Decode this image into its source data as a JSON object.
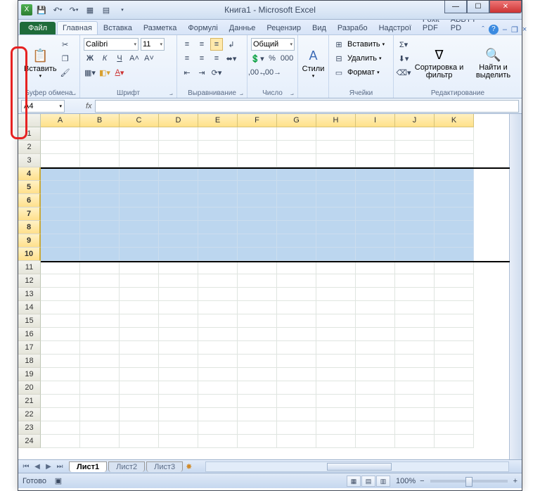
{
  "titlebar": {
    "title": "Книга1 - Microsoft Excel"
  },
  "tabs": {
    "file": "Файл",
    "items": [
      "Главная",
      "Вставка",
      "Разметка",
      "Формулі",
      "Даннье",
      "Рецензир",
      "Вид",
      "Разрабо",
      "Надстрої",
      "Foxit PDF",
      "ABBYY PD"
    ]
  },
  "ribbon": {
    "clipboard": {
      "paste": "Вставить",
      "label": "Буфер обмена"
    },
    "font": {
      "name": "Calibri",
      "size": "11",
      "label": "Шрифт"
    },
    "align": {
      "label": "Выравнивание"
    },
    "number": {
      "format": "Общий",
      "label": "Число"
    },
    "styles": {
      "btn": "Стили"
    },
    "cells": {
      "insert": "Вставить",
      "delete": "Удалить",
      "format": "Формат",
      "label": "Ячейки"
    },
    "editing": {
      "sort": "Сортировка и фильтр",
      "find": "Найти и выделить",
      "label": "Редактирование"
    }
  },
  "namebox": "A4",
  "columns": [
    "A",
    "B",
    "C",
    "D",
    "E",
    "F",
    "G",
    "H",
    "I",
    "J",
    "K"
  ],
  "rows": [
    1,
    2,
    3,
    4,
    5,
    6,
    7,
    8,
    9,
    10,
    11,
    12,
    13,
    14,
    15,
    16,
    17,
    18,
    19,
    20,
    21,
    22,
    23,
    24
  ],
  "selection": {
    "startRow": 4,
    "endRow": 10
  },
  "sheets": {
    "active": "Лист1",
    "others": [
      "Лист2",
      "Лист3"
    ]
  },
  "status": {
    "ready": "Готово",
    "zoom": "100%"
  }
}
